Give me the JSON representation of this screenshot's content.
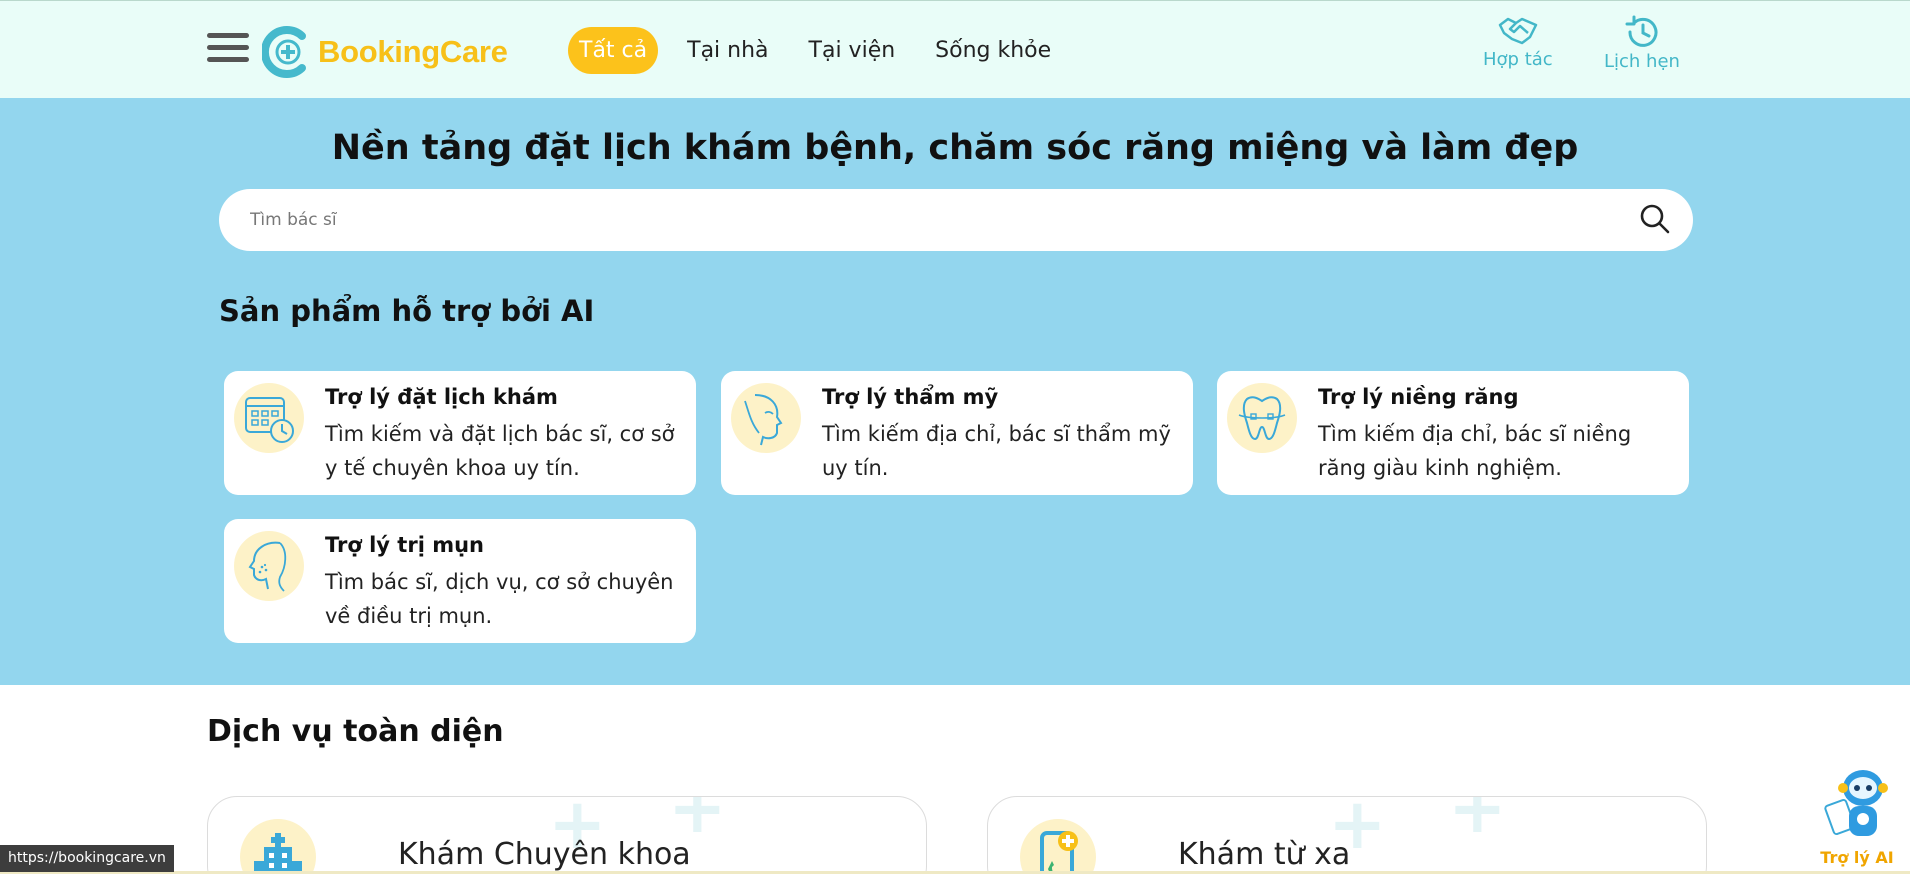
{
  "header": {
    "logo_text": "BookingCare",
    "nav": [
      {
        "label": "Tất cả",
        "active": true
      },
      {
        "label": "Tại nhà",
        "active": false
      },
      {
        "label": "Tại viện",
        "active": false
      },
      {
        "label": "Sống khỏe",
        "active": false
      }
    ],
    "actions": [
      {
        "label": "Hợp tác",
        "icon": "handshake-icon"
      },
      {
        "label": "Lịch hẹn",
        "icon": "history-icon"
      }
    ]
  },
  "hero": {
    "title": "Nền tảng đặt lịch khám bệnh, chăm sóc răng miệng và làm đẹp",
    "search_placeholder": "Tìm bác sĩ",
    "ai_heading": "Sản phẩm hỗ trợ bởi AI",
    "ai_cards": [
      {
        "title": "Trợ lý đặt lịch khám",
        "desc": "Tìm kiếm và đặt lịch bác sĩ, cơ sở y tế chuyên khoa uy tín.",
        "icon": "calendar-clock-icon"
      },
      {
        "title": "Trợ lý thẩm mỹ",
        "desc": "Tìm kiếm địa chỉ, bác sĩ thẩm mỹ uy tín.",
        "icon": "face-profile-icon"
      },
      {
        "title": "Trợ lý niềng răng",
        "desc": "Tìm kiếm địa chỉ, bác sĩ niềng răng giàu kinh nghiệm.",
        "icon": "tooth-icon"
      },
      {
        "title": "Trợ lý trị mụn",
        "desc": "Tìm bác sĩ, dịch vụ, cơ sở chuyên về điều trị mụn.",
        "icon": "acne-face-icon"
      }
    ]
  },
  "services": {
    "heading": "Dịch vụ toàn diện",
    "items": [
      {
        "title": "Khám Chuyên khoa",
        "icon": "hospital-icon"
      },
      {
        "title": "Khám từ xa",
        "icon": "phone-medical-icon"
      }
    ]
  },
  "status_url": "https://bookingcare.vn",
  "ai_assistant_label": "Trợ lý AI",
  "colors": {
    "header_bg": "#e9fdf8",
    "hero_bg": "#93d6ee",
    "accent_yellow": "#fcc21b",
    "accent_teal": "#43b7c8"
  }
}
